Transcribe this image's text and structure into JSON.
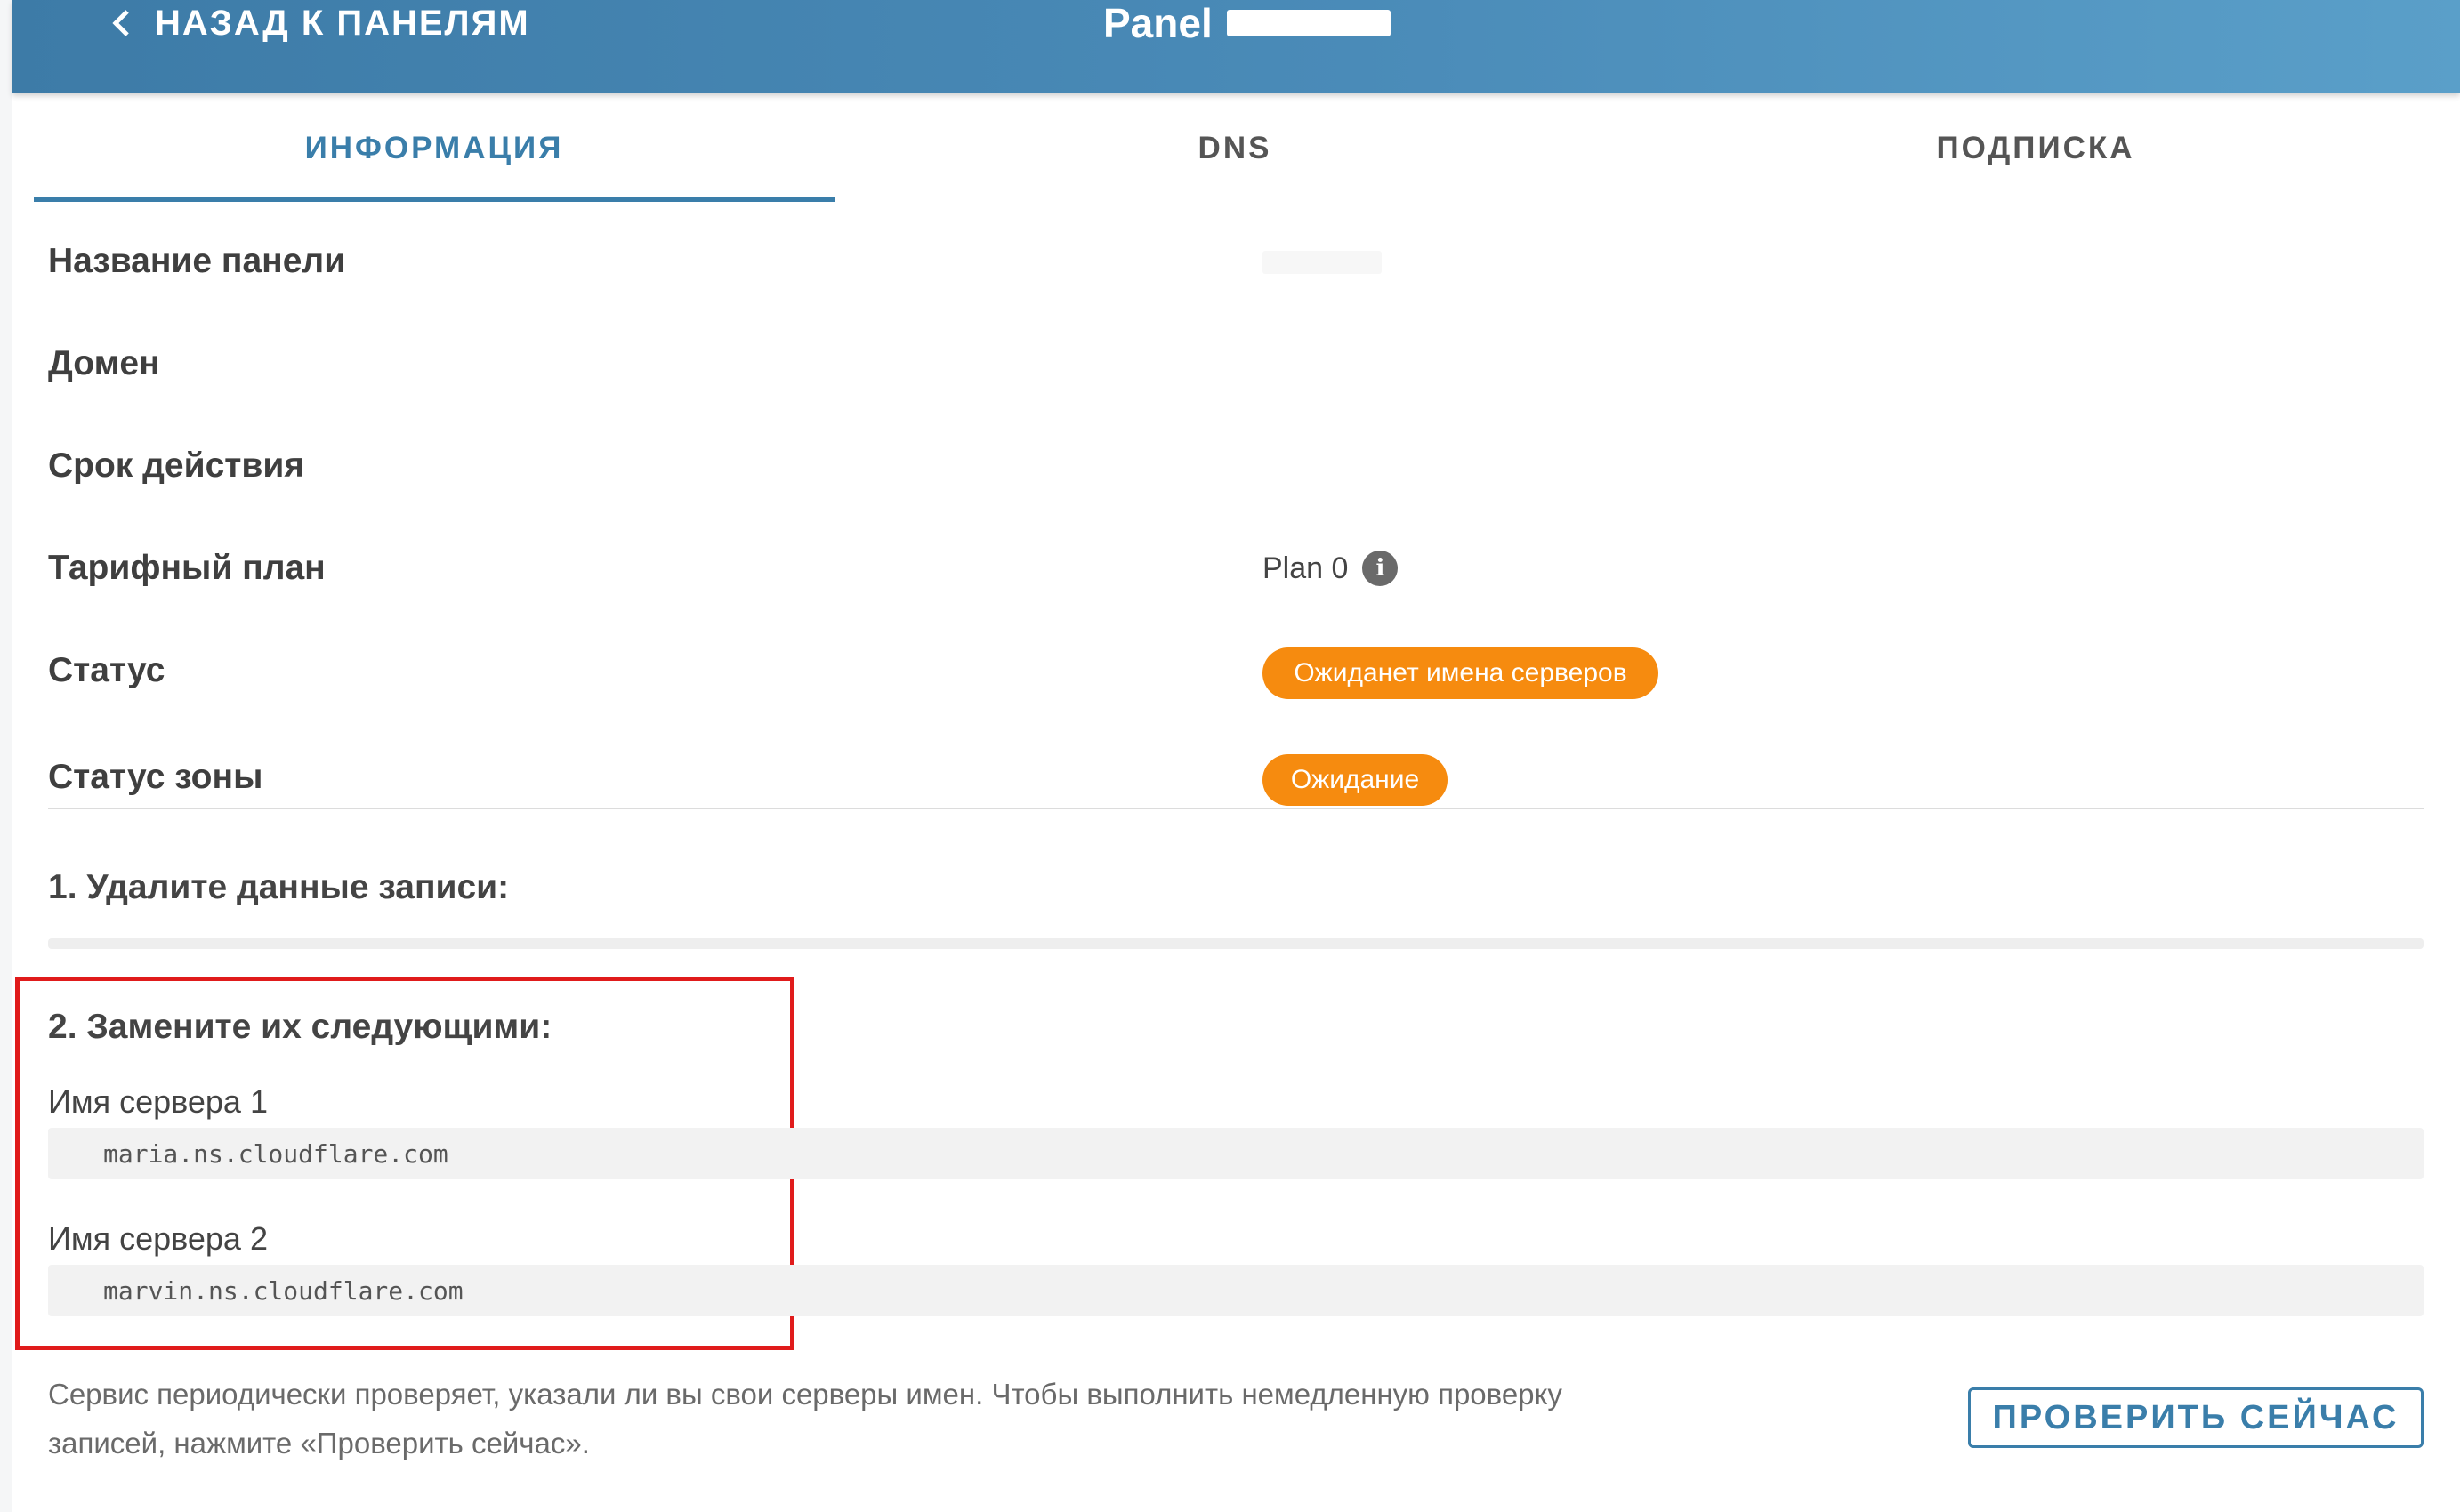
{
  "header": {
    "back_label": "НАЗАД К ПАНЕЛЯМ",
    "title_prefix": "Panel",
    "icons": {
      "back": "chevron-left-icon"
    }
  },
  "tabs": [
    {
      "label": "ИНФОРМАЦИЯ",
      "active": true
    },
    {
      "label": "DNS",
      "active": false
    },
    {
      "label": "ПОДПИСКА",
      "active": false
    }
  ],
  "info": {
    "panel_name_label": "Название панели",
    "domain_label": "Домен",
    "expiry_label": "Срок действия",
    "plan_label": "Тарифный план",
    "plan_value": "Plan 0",
    "status_label": "Статус",
    "status_value": "Ожиданет имена серверов",
    "zone_status_label": "Статус зоны",
    "zone_status_value": "Ожидание"
  },
  "steps": {
    "step1_heading": "1. Удалите данные записи:",
    "step2_heading": "2. Замените их следующими:",
    "ns1_label": "Имя сервера 1",
    "ns1_value": "maria.ns.cloudflare.com",
    "ns2_label": "Имя сервера 2",
    "ns2_value": "marvin.ns.cloudflare.com"
  },
  "footer": {
    "note": "Сервис периодически проверяет, указали ли вы свои серверы имен. Чтобы выполнить немедленную проверку записей, нажмите «Проверить сейчас».",
    "check_button": "ПРОВЕРИТЬ СЕЙЧАС"
  },
  "colors": {
    "header": "#4a8bb8",
    "accent": "#3a7eaa",
    "badge": "#f68b0f",
    "highlight": "#e01b1b"
  }
}
